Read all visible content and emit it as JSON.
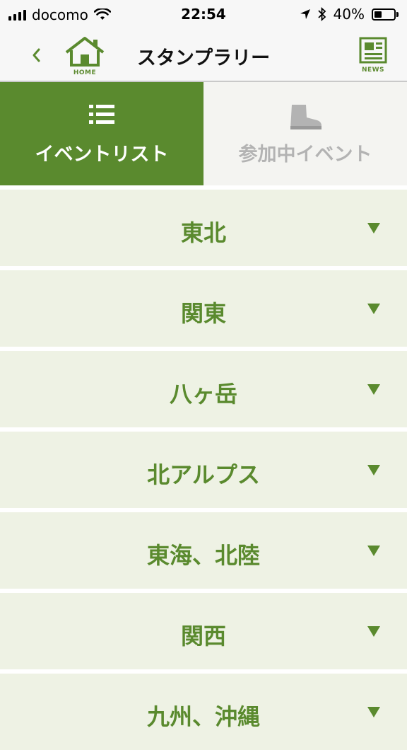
{
  "status": {
    "carrier": "docomo",
    "time": "22:54",
    "battery": "40%",
    "battery_level": 0.4
  },
  "nav": {
    "title": "スタンプラリー",
    "home_label": "HOME",
    "news_label": "NEWS"
  },
  "tabs": {
    "event_list": "イベントリスト",
    "participating": "参加中イベント"
  },
  "regions": [
    {
      "label": "東北"
    },
    {
      "label": "関東"
    },
    {
      "label": "八ヶ岳"
    },
    {
      "label": "北アルプス"
    },
    {
      "label": "東海、北陸"
    },
    {
      "label": "関西"
    },
    {
      "label": "九州、沖縄"
    }
  ],
  "colors": {
    "accent": "#5a8a2e",
    "row_background": "#eef2e4",
    "inactive_tab": "#f4f4f1",
    "inactive_text": "#b3b3b3"
  }
}
